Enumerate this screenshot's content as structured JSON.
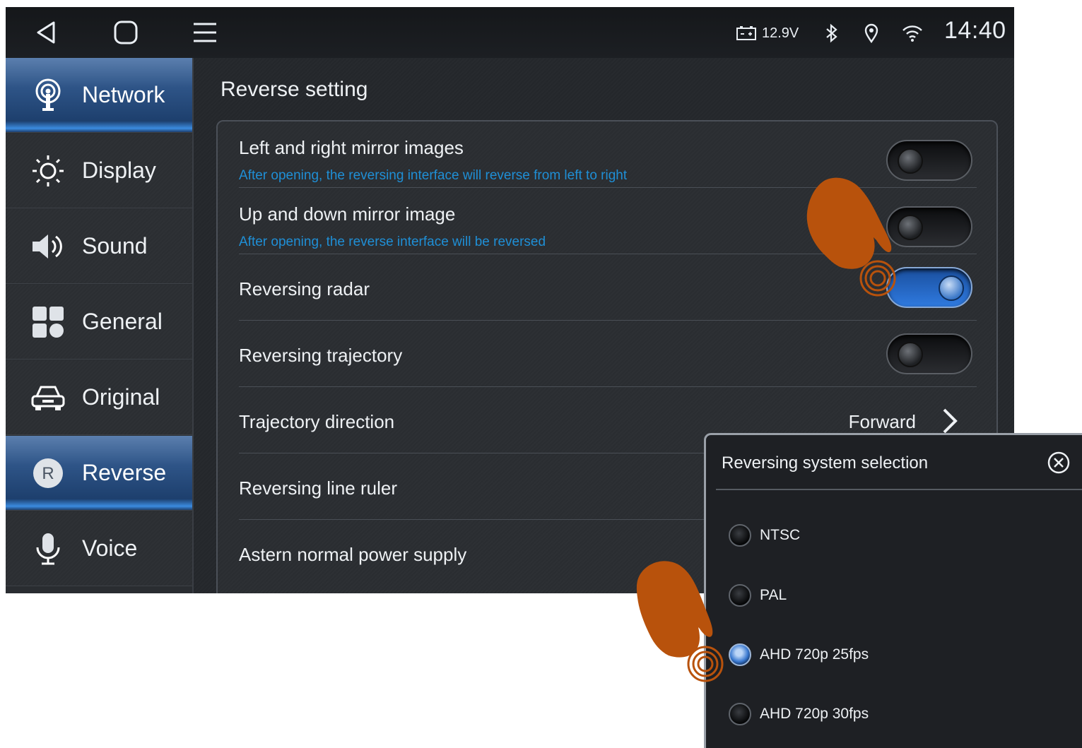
{
  "status_bar": {
    "battery_voltage": "12.9V",
    "time": "14:40",
    "icons": [
      "back-icon",
      "home-icon",
      "menu-icon",
      "battery-icon",
      "bluetooth-icon",
      "location-icon",
      "wifi-icon"
    ]
  },
  "sidebar": {
    "items": [
      {
        "label": "Network",
        "icon": "network-icon",
        "active": true
      },
      {
        "label": "Display",
        "icon": "brightness-icon",
        "active": false
      },
      {
        "label": "Sound",
        "icon": "speaker-icon",
        "active": false
      },
      {
        "label": "General",
        "icon": "grid-icon",
        "active": false
      },
      {
        "label": "Original",
        "icon": "car-icon",
        "active": false
      },
      {
        "label": "Reverse",
        "icon": "reverse-icon",
        "active": true
      },
      {
        "label": "Voice",
        "icon": "microphone-icon",
        "active": false
      }
    ],
    "reverse_badge": "R"
  },
  "main": {
    "title": "Reverse setting",
    "rows": [
      {
        "label": "Left and right mirror images",
        "desc": "After opening, the reversing interface will reverse from left to right",
        "type": "toggle",
        "on": false
      },
      {
        "label": "Up and down mirror image",
        "desc": "After opening, the reverse interface will be reversed",
        "type": "toggle",
        "on": false
      },
      {
        "label": "Reversing radar",
        "type": "toggle",
        "on": true
      },
      {
        "label": "Reversing trajectory",
        "type": "toggle",
        "on": false
      },
      {
        "label": "Trajectory direction",
        "type": "select",
        "value": "Forward"
      },
      {
        "label": "Reversing line ruler",
        "type": "select"
      },
      {
        "label": "Astern normal power supply",
        "type": "toggle"
      }
    ]
  },
  "dialog": {
    "title": "Reversing system selection",
    "options": [
      {
        "label": "NTSC",
        "selected": false
      },
      {
        "label": "PAL",
        "selected": false
      },
      {
        "label": "AHD 720p 25fps",
        "selected": true
      },
      {
        "label": "AHD 720p 30fps",
        "selected": false
      }
    ]
  },
  "colors": {
    "accent_blue": "#2f7ae0",
    "description_text": "#1f8fd6",
    "hand_orange": "#b8520c"
  }
}
